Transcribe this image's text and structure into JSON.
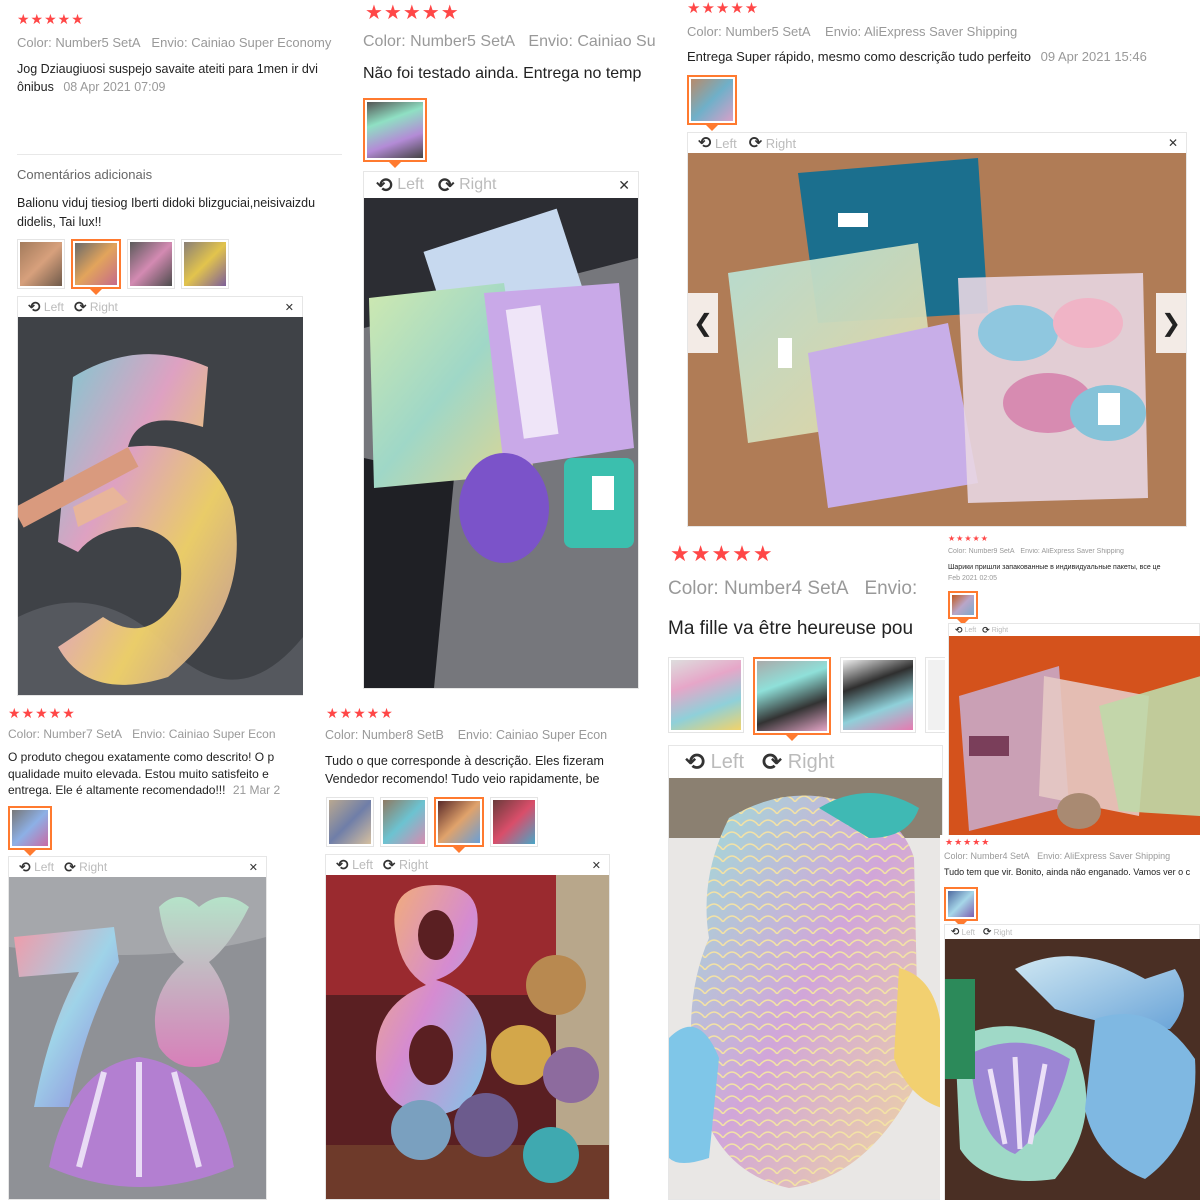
{
  "common": {
    "stars": "★★★★★",
    "color_label": "Color:",
    "envio_label": "Envio:",
    "left_label": "Left",
    "right_label": "Right",
    "rotate_left_glyph": "⟲",
    "rotate_right_glyph": "⟳",
    "close_glyph": "✕",
    "prev_glyph": "❮",
    "next_glyph": "❯"
  },
  "colors": {
    "star": "#ff4747",
    "thumb_active": "#ff7a2f",
    "muted": "#999999"
  },
  "reviews": [
    {
      "color": "Number5 SetA",
      "envio": "Cainiao Super Economy",
      "text": "Jog Dziaugiuosi suspejo savaite ateiti para 1men ir dvi ônibus",
      "date": "08 Apr 2021 07:09",
      "additional_heading": "Comentários adicionais",
      "additional_text": "Balionu viduj tiesiog Iberti didoki blizguciai,neisivaizdu didelis, Tai lux!!"
    },
    {
      "color": "Number5 SetA",
      "envio": "Cainiao Su",
      "text": "Não foi testado ainda. Entrega no temp"
    },
    {
      "color": "Number5 SetA",
      "envio": "AliExpress Saver Shipping",
      "text": "Entrega Super rápido, mesmo como descrição tudo perfeito",
      "date": "09 Apr 2021 15:46"
    },
    {
      "color": "Number4 SetA",
      "envio": "Envio:",
      "text": "Ma fille va être heureuse pou"
    },
    {
      "color": "Number9 SetA",
      "envio": "AliExpress Saver Shipping",
      "text": "Шарики пришли запакованные в индивидуальные пакеты, все це",
      "date": "Feb 2021 02:05"
    },
    {
      "color": "Number7 SetA",
      "envio": "Cainiao Super Econ",
      "text": "O produto chegou exatamente como descrito! O p qualidade muito elevada. Estou muito satisfeito e entrega. Ele é altamente recomendado!!!",
      "date": "21 Mar 2"
    },
    {
      "color": "Number8 SetB",
      "envio": "Cainiao Super Econ",
      "text": "Tudo o que corresponde à descrição. Eles fizeram Vendedor recomendo! Tudo veio rapidamente, be"
    },
    {
      "color": "Number4 SetA",
      "envio": "AliExpress Saver Shipping",
      "text": "Tudo tem que vir. Bonito, ainda não enganado. Vamos ver o c"
    }
  ]
}
